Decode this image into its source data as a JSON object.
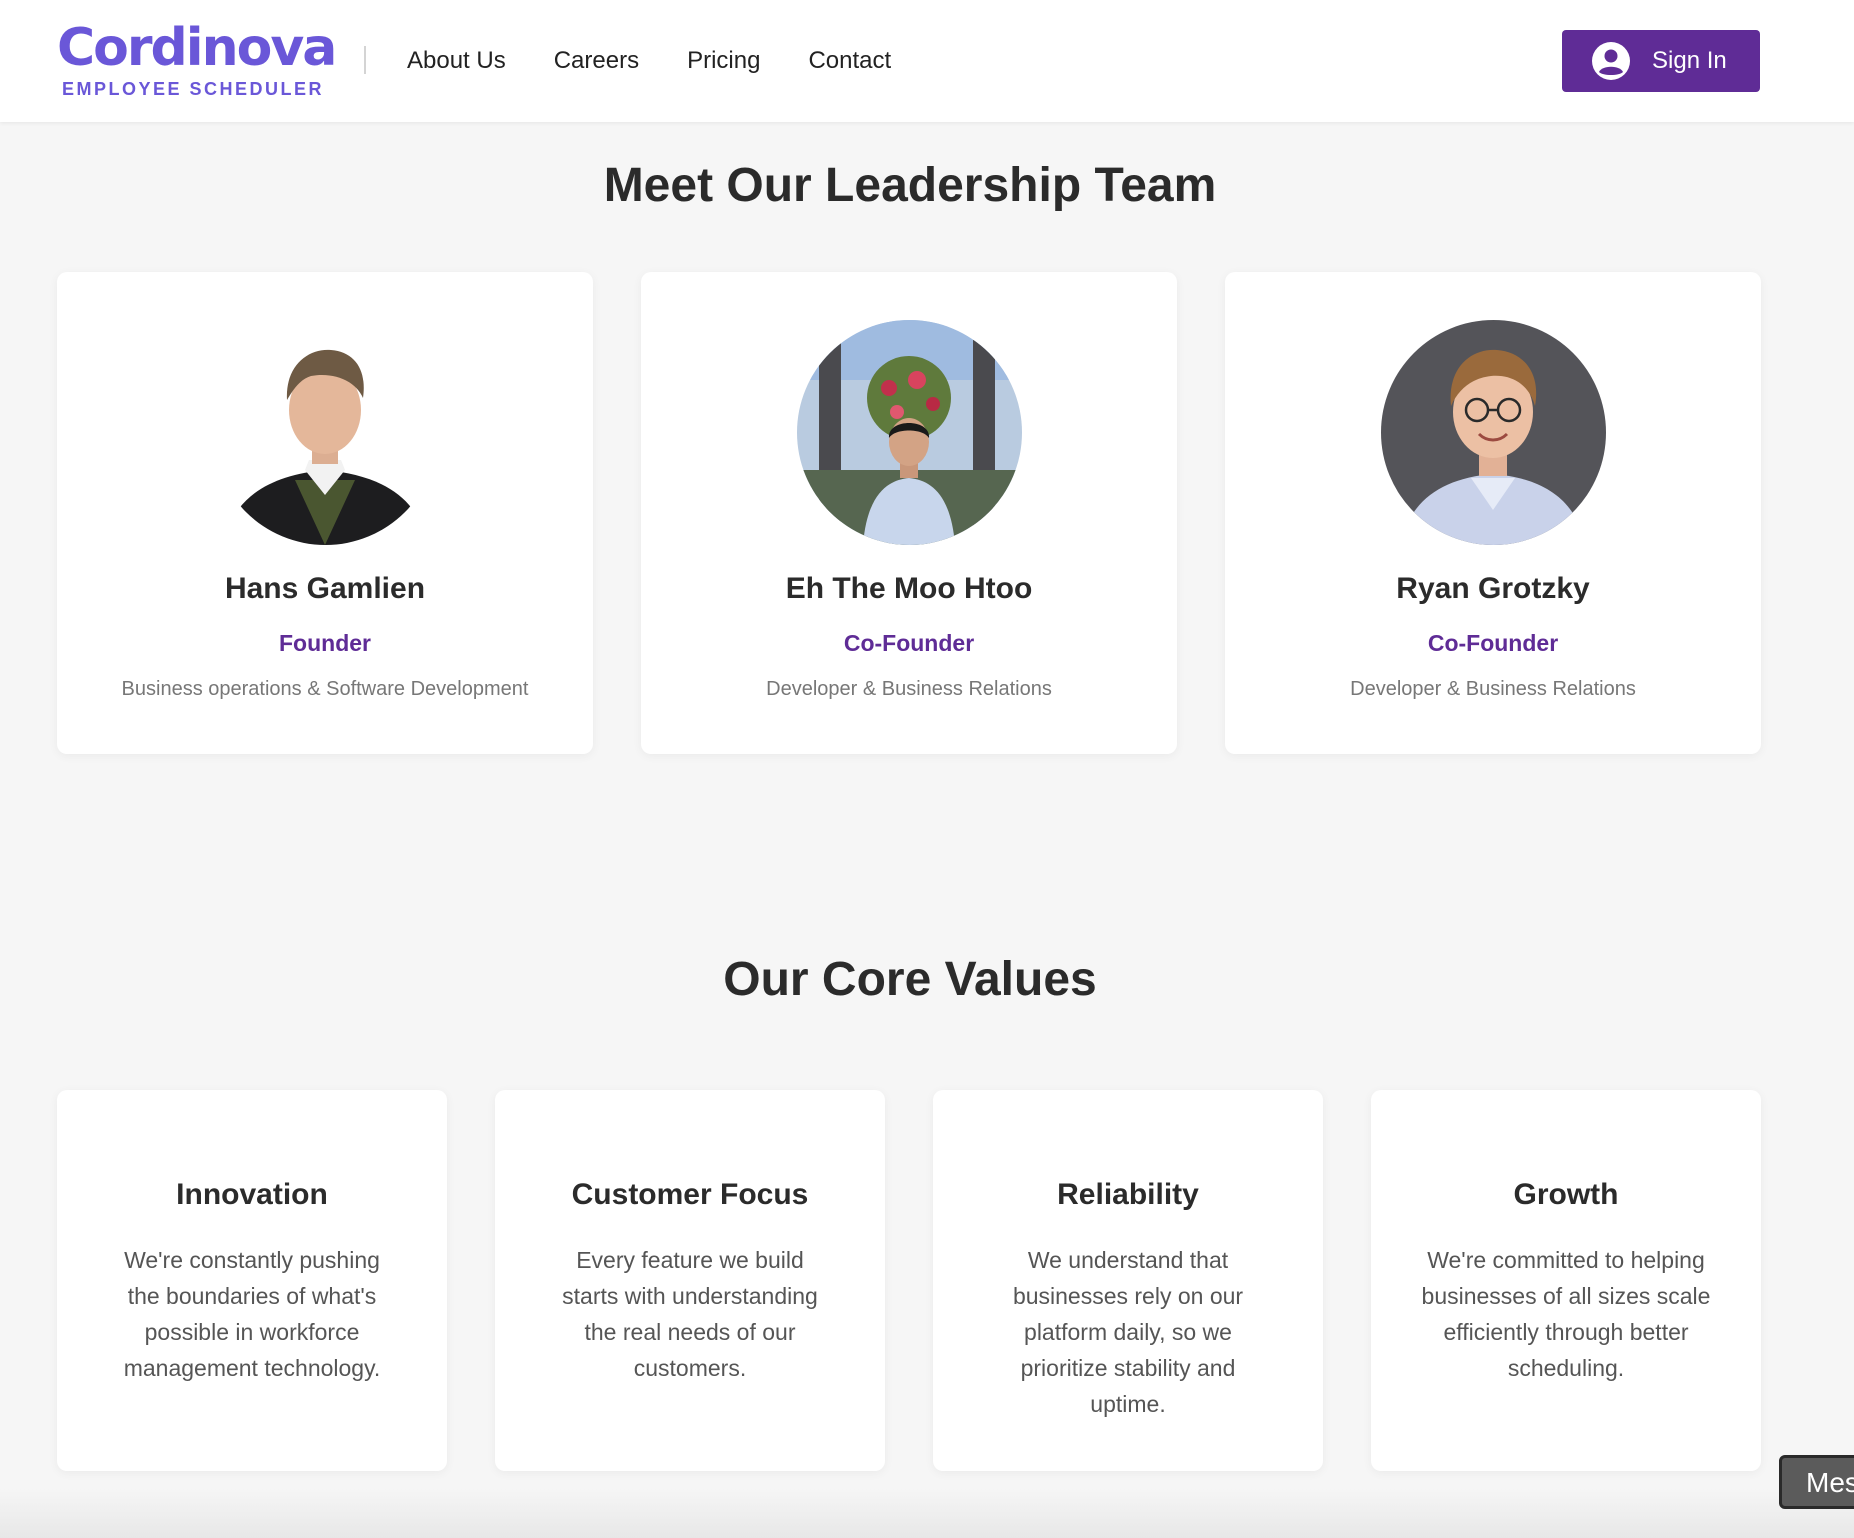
{
  "header": {
    "logo_name": "Cordinova",
    "logo_sub": "EMPLOYEE SCHEDULER",
    "nav": [
      "About Us",
      "Careers",
      "Pricing",
      "Contact"
    ],
    "signin_label": "Sign In",
    "signin_icon": "user-circle-icon",
    "accent_color": "#5f2c96"
  },
  "leadership": {
    "title": "Meet Our Leadership Team",
    "members": [
      {
        "name": "Hans Gamlien",
        "role": "Founder",
        "description": "Business operations & Software Development"
      },
      {
        "name": "Eh The Moo Htoo",
        "role": "Co-Founder",
        "description": "Developer & Business Relations"
      },
      {
        "name": "Ryan Grotzky",
        "role": "Co-Founder",
        "description": "Developer & Business Relations"
      }
    ]
  },
  "values": {
    "title": "Our Core Values",
    "items": [
      {
        "title": "Innovation",
        "description": "We're constantly pushing the boundaries of what's possible in workforce management technology."
      },
      {
        "title": "Customer Focus",
        "description": "Every feature we build starts with understanding the real needs of our customers."
      },
      {
        "title": "Reliability",
        "description": "We understand that businesses rely on our platform daily, so we prioritize stability and uptime."
      },
      {
        "title": "Growth",
        "description": "We're committed to helping businesses of all sizes scale efficiently through better scheduling."
      }
    ]
  },
  "message_widget": {
    "label": "Mes"
  }
}
